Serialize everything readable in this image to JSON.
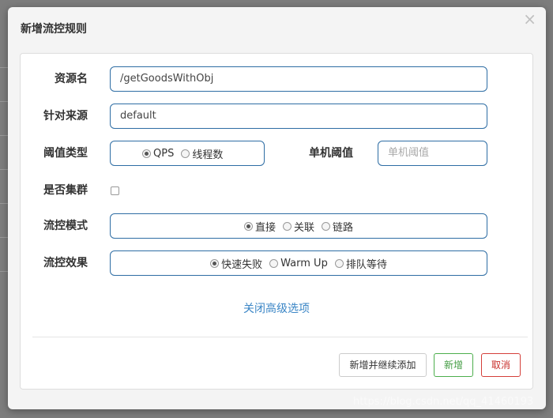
{
  "dialog": {
    "title": "新增流控规则",
    "close_symbol": "×"
  },
  "form": {
    "resource": {
      "label": "资源名",
      "value": "/getGoodsWithObj"
    },
    "limit_app": {
      "label": "针对来源",
      "value": "default"
    },
    "grade": {
      "label": "阈值类型",
      "options": [
        {
          "label": "QPS",
          "checked": true
        },
        {
          "label": "线程数",
          "checked": false
        }
      ]
    },
    "threshold": {
      "label": "单机阈值",
      "placeholder": "单机阈值"
    },
    "cluster": {
      "label": "是否集群",
      "checked": false
    },
    "strategy": {
      "label": "流控模式",
      "options": [
        {
          "label": "直接",
          "checked": true
        },
        {
          "label": "关联",
          "checked": false
        },
        {
          "label": "链路",
          "checked": false
        }
      ]
    },
    "control_behavior": {
      "label": "流控效果",
      "options": [
        {
          "label": "快速失败",
          "checked": true
        },
        {
          "label": "Warm Up",
          "checked": false
        },
        {
          "label": "排队等待",
          "checked": false
        }
      ]
    },
    "advanced_toggle": "关闭高级选项"
  },
  "footer": {
    "add_continue_label": "新增并继续添加",
    "add_label": "新增",
    "cancel_label": "取消"
  },
  "watermark": "https://blog.csdn.net/qq_41460193",
  "colors": {
    "input_border": "#2e6da4",
    "link": "#3b86c6",
    "success": "#449d44",
    "danger": "#c9302c"
  }
}
